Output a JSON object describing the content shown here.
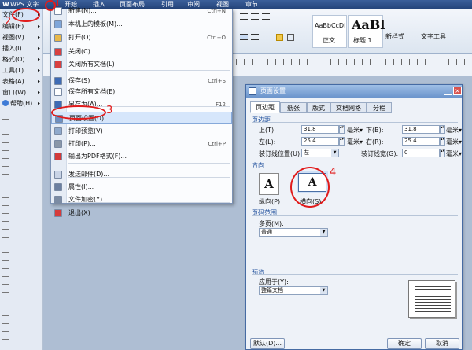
{
  "titlebar": {
    "app": "WPS 文字",
    "tabs": [
      "开始",
      "插入",
      "页面布局",
      "引用",
      "审阅",
      "视图",
      "章节"
    ]
  },
  "ribbon": {
    "styles": [
      {
        "sample": "AaBbCcDi",
        "name": "正文"
      },
      {
        "sample": "AaBl",
        "name": "标题 1"
      }
    ],
    "newstyle": "新样式",
    "wordtool": "文字工具"
  },
  "leftmenu": [
    {
      "label": "文件(F)"
    },
    {
      "label": "编辑(E)"
    },
    {
      "label": "视图(V)"
    },
    {
      "label": "插入(I)"
    },
    {
      "label": "格式(O)"
    },
    {
      "label": "工具(T)"
    },
    {
      "label": "表格(A)"
    },
    {
      "label": "窗口(W)"
    },
    {
      "label": "帮助(H)"
    }
  ],
  "filemenu": [
    {
      "label": "新建(N)...",
      "shortcut": "Ctrl+N",
      "icon": "new-doc-icon",
      "color": "#ffffff"
    },
    {
      "label": "本机上的模板(M)...",
      "shortcut": "",
      "icon": "template-icon",
      "color": "#7fa6d9"
    },
    {
      "label": "打开(O)...",
      "shortcut": "Ctrl+O",
      "icon": "open-folder-icon",
      "color": "#e8b84a"
    },
    {
      "label": "关闭(C)",
      "shortcut": "",
      "icon": "close-doc-icon",
      "color": "#d84040"
    },
    {
      "label": "关闭所有文档(L)",
      "shortcut": "",
      "icon": "close-all-icon",
      "color": "#d84040"
    },
    {
      "label": "保存(S)",
      "shortcut": "Ctrl+S",
      "icon": "save-icon",
      "color": "#3e6bb5"
    },
    {
      "label": "保存所有文档(E)",
      "shortcut": "",
      "icon": "save-all-icon",
      "color": "#ffffff"
    },
    {
      "label": "另存为(A)...",
      "shortcut": "F12",
      "icon": "save-as-icon",
      "color": "#3e6bb5"
    },
    {
      "label": "页面设置(U)...",
      "shortcut": "",
      "icon": "page-setup-icon",
      "color": "#6d8fc2"
    },
    {
      "label": "打印预览(V)",
      "shortcut": "",
      "icon": "print-preview-icon",
      "color": "#8fa9cc"
    },
    {
      "label": "打印(P)...",
      "shortcut": "Ctrl+P",
      "icon": "print-icon",
      "color": "#8a97a8"
    },
    {
      "label": "输出为PDF格式(F)...",
      "shortcut": "",
      "icon": "pdf-icon",
      "color": "#d23a3a"
    },
    {
      "label": "发送邮件(D)...",
      "shortcut": "",
      "icon": "mail-icon",
      "color": "#c9d4e6"
    },
    {
      "label": "属性(I)...",
      "shortcut": "",
      "icon": "properties-icon",
      "color": "#6b7fa0"
    },
    {
      "label": "文件加密(Y)...",
      "shortcut": "",
      "icon": "encrypt-icon",
      "color": "#7b8ba3"
    },
    {
      "label": "退出(X)",
      "shortcut": "",
      "icon": "exit-icon",
      "color": "#d63b3b"
    }
  ],
  "annotations": [
    "1",
    "2",
    "3",
    "4"
  ],
  "dialog": {
    "title": "页面设置",
    "tabs": [
      "页边距",
      "纸张",
      "版式",
      "文档网格",
      "分栏"
    ],
    "margins_title": "页边距",
    "top_label": "上(T):",
    "top_value": "31.8",
    "top_unit": "毫米▾",
    "bottom_label": "下(B):",
    "bottom_value": "31.8",
    "bottom_unit": "毫米▾",
    "left_label": "左(L):",
    "left_value": "25.4",
    "left_unit": "毫米▾",
    "right_label": "右(R):",
    "right_value": "25.4",
    "right_unit": "毫米▾",
    "gutter_pos_label": "装订线位置(U):",
    "gutter_pos_value": "左",
    "gutter_label": "装订线宽(G):",
    "gutter_value": "0",
    "gutter_unit": "毫米▾",
    "orientation_title": "方向",
    "portrait": "纵向(P)",
    "landscape": "横向(S)",
    "pages_title": "页码范围",
    "multipage_label": "多页(M):",
    "multipage_value": "普通",
    "preview_title": "预览",
    "apply_label": "应用于(Y):",
    "apply_value": "整篇文档",
    "default_btn": "默认(D)...",
    "ok_btn": "确定",
    "cancel_btn": "取消"
  }
}
